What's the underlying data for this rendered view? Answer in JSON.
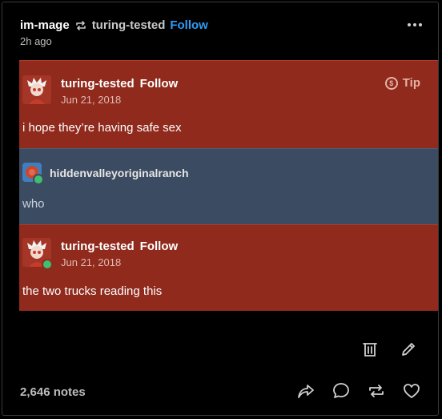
{
  "header": {
    "user": "im-mage",
    "source_user": "turing-tested",
    "follow_label": "Follow",
    "time": "2h ago"
  },
  "trail": [
    {
      "username": "turing-tested",
      "follow_label": "Follow",
      "date": "Jun 21, 2018",
      "text": "i hope they’re having safe sex",
      "tip_label": "Tip"
    },
    {
      "username": "hiddenvalleyoriginalranch",
      "text": "who"
    },
    {
      "username": "turing-tested",
      "follow_label": "Follow",
      "date": "Jun 21, 2018",
      "text": "the two trucks reading this"
    }
  ],
  "footer": {
    "notes": "2,646 notes"
  },
  "icons": {
    "more": "more-icon",
    "reblog": "reblog-icon",
    "tip": "tip-icon",
    "delete": "delete-icon",
    "edit": "edit-icon",
    "share": "share-icon",
    "reply": "reply-icon",
    "reblog_action": "reblog-icon",
    "like": "like-icon"
  },
  "colors": {
    "background": "#000000",
    "block_red": "#8f2a1d",
    "block_blue": "#3b4b61",
    "follow_blue": "#2e9df7",
    "badge_green": "#3fbf70"
  }
}
